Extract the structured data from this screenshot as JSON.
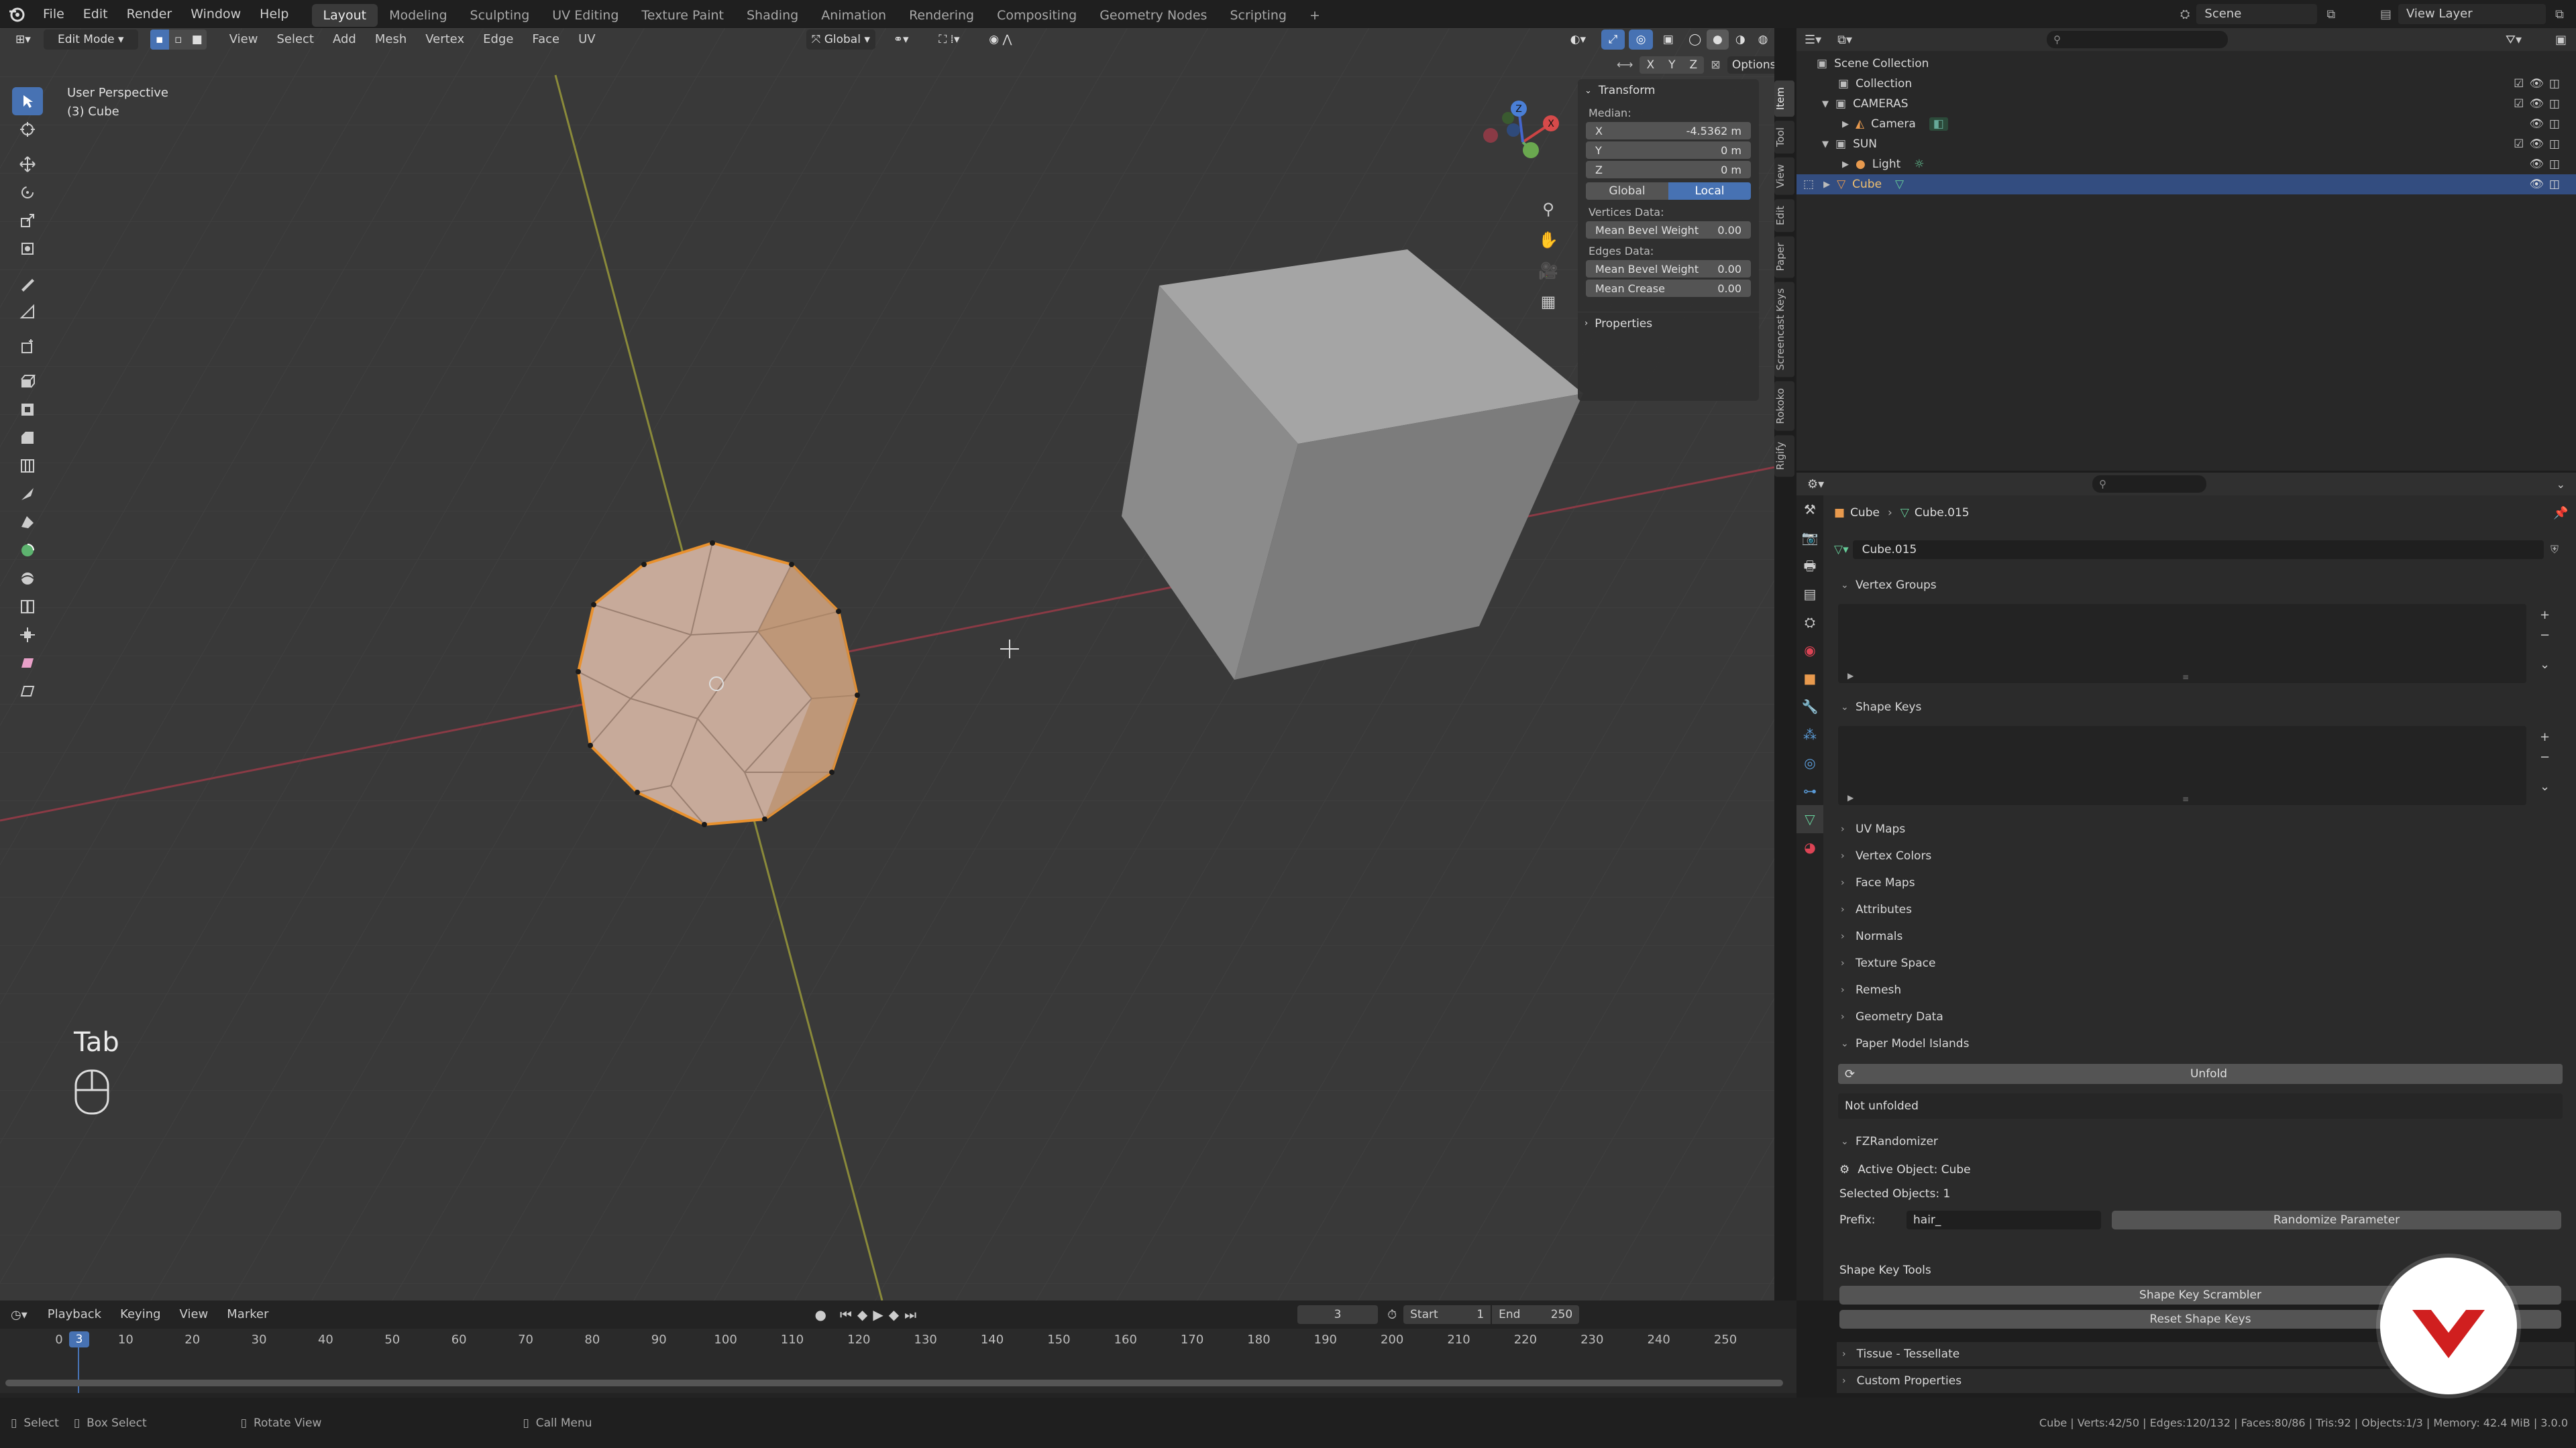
{
  "menubar": {
    "items": [
      "File",
      "Edit",
      "Render",
      "Window",
      "Help"
    ]
  },
  "workspaces": [
    "Layout",
    "Modeling",
    "Sculpting",
    "UV Editing",
    "Texture Paint",
    "Shading",
    "Animation",
    "Rendering",
    "Compositing",
    "Geometry Nodes",
    "Scripting"
  ],
  "active_workspace": "Layout",
  "scene": "Scene",
  "view_layer": "View Layer",
  "viewport": {
    "mode": "Edit Mode",
    "menus": [
      "View",
      "Select",
      "Add",
      "Mesh",
      "Vertex",
      "Edge",
      "Face",
      "UV"
    ],
    "orientation": "Global",
    "options": "Options",
    "axes": [
      "X",
      "Y",
      "Z"
    ],
    "perspective": "User Perspective",
    "object_label": "(3) Cube",
    "key_hint": "Tab"
  },
  "npanel": {
    "title": "Transform",
    "median": "Median:",
    "x_label": "X",
    "x_val": "-4.5362 m",
    "y_label": "Y",
    "y_val": "0 m",
    "z_label": "Z",
    "z_val": "0 m",
    "global": "Global",
    "local": "Local",
    "vertices_data": "Vertices Data:",
    "mbw_label": "Mean Bevel Weight",
    "mbw_val": "0.00",
    "edges_data": "Edges Data:",
    "embw_label": "Mean Bevel Weight",
    "embw_val": "0.00",
    "crease_label": "Mean Crease",
    "crease_val": "0.00",
    "properties": "Properties"
  },
  "side_tabs": [
    "Item",
    "Tool",
    "View",
    "Edit",
    "Paper",
    "Screencast Keys",
    "Rokoko",
    "Rigify"
  ],
  "outliner": {
    "scene_collection": "Scene Collection",
    "collection": "Collection",
    "cameras": "CAMERAS",
    "camera": "Camera",
    "sun": "SUN",
    "light": "Light",
    "cube": "Cube"
  },
  "properties": {
    "breadcrumb_obj": "Cube",
    "breadcrumb_mesh": "Cube.015",
    "mesh_name": "Cube.015",
    "panels": {
      "vertex_groups": "Vertex Groups",
      "shape_keys": "Shape Keys",
      "uv_maps": "UV Maps",
      "vertex_colors": "Vertex Colors",
      "face_maps": "Face Maps",
      "attributes": "Attributes",
      "normals": "Normals",
      "texture_space": "Texture Space",
      "remesh": "Remesh",
      "geometry_data": "Geometry Data",
      "paper_model": "Paper Model Islands",
      "fzrandomizer": "FZRandomizer",
      "tissue": "Tissue - Tessellate",
      "custom": "Custom Properties"
    },
    "unfold": "Unfold",
    "not_unfolded": "Not unfolded",
    "active_object": "Active Object: Cube",
    "selected_objects": "Selected Objects: 1",
    "prefix_label": "Prefix:",
    "prefix_val": "hair_",
    "randomize": "Randomize Parameter",
    "shape_key_tools": "Shape Key Tools",
    "scrambler": "Shape Key Scrambler",
    "reset": "Reset Shape Keys"
  },
  "timeline": {
    "menus": [
      "Playback",
      "Keying",
      "View",
      "Marker"
    ],
    "current_frame": "3",
    "start_label": "Start",
    "start_val": "1",
    "end_label": "End",
    "end_val": "250",
    "ticks": [
      "0",
      "10",
      "20",
      "30",
      "40",
      "50",
      "60",
      "70",
      "80",
      "90",
      "100",
      "110",
      "120",
      "130",
      "140",
      "150",
      "160",
      "170",
      "180",
      "190",
      "200",
      "210",
      "220",
      "230",
      "240",
      "250"
    ]
  },
  "statusbar": {
    "select": "Select",
    "box_select": "Box Select",
    "rotate": "Rotate View",
    "call_menu": "Call Menu",
    "stats": "Cube | Verts:42/50 | Edges:120/132 | Faces:80/86 | Tris:92 | Objects:1/3 | Memory: 42.4 MiB | 3.0.0"
  },
  "colors": {
    "accent": "#4772b3",
    "selection_orange": "#e8912e",
    "brand_red": "#d01f1f"
  }
}
